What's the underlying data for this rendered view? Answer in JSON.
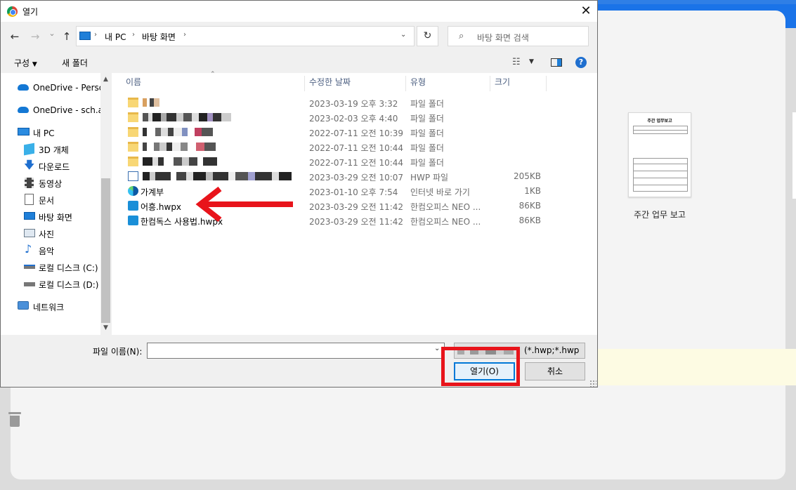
{
  "dialog": {
    "title": "열기",
    "close_glyph": "✕",
    "nav": {
      "back": "←",
      "forward": "→",
      "recent": "⌄",
      "up": "↑"
    },
    "breadcrumb": [
      "내 PC",
      "바탕 화면"
    ],
    "breadcrumb_sep": "›",
    "refresh_glyph": "↻",
    "search_placeholder": "바탕 화면 검색",
    "search_glyph": "⌕",
    "toolbar": {
      "organize": "구성",
      "new_folder": "새 폴더",
      "help": "?"
    },
    "sidebar": [
      {
        "label": "OneDrive - Personal",
        "icon": "onedrive-icon"
      },
      {
        "label": "OneDrive - sch.ac.kr",
        "icon": "onedrive-icon"
      },
      {
        "label": "내 PC",
        "icon": "pc-icon"
      },
      {
        "label": "3D 개체",
        "icon": "3d-objects-icon"
      },
      {
        "label": "다운로드",
        "icon": "download-icon"
      },
      {
        "label": "동영상",
        "icon": "video-icon"
      },
      {
        "label": "문서",
        "icon": "document-icon"
      },
      {
        "label": "바탕 화면",
        "icon": "desktop-icon"
      },
      {
        "label": "사진",
        "icon": "pictures-icon"
      },
      {
        "label": "음악",
        "icon": "music-icon"
      },
      {
        "label": "로컬 디스크 (C:)",
        "icon": "drive-icon"
      },
      {
        "label": "로컬 디스크 (D:)",
        "icon": "drive-icon"
      },
      {
        "label": "네트워크",
        "icon": "network-icon"
      }
    ],
    "columns": {
      "name": "이름",
      "date": "수정한 날짜",
      "type": "유형",
      "size": "크기"
    },
    "files": [
      {
        "name": "",
        "date": "2023-03-19 오후 3:32",
        "type": "파일 폴더",
        "size": "",
        "icon": "folder-icon",
        "blurred": true
      },
      {
        "name": "",
        "date": "2023-02-03 오후 4:40",
        "type": "파일 폴더",
        "size": "",
        "icon": "folder-icon",
        "blurred": true
      },
      {
        "name": "",
        "date": "2022-07-11 오전 10:39",
        "type": "파일 폴더",
        "size": "",
        "icon": "folder-icon",
        "blurred": true
      },
      {
        "name": "",
        "date": "2022-07-11 오전 10:44",
        "type": "파일 폴더",
        "size": "",
        "icon": "folder-icon",
        "blurred": true
      },
      {
        "name": "",
        "date": "2022-07-11 오전 10:44",
        "type": "파일 폴더",
        "size": "",
        "icon": "folder-icon",
        "blurred": true
      },
      {
        "name": "",
        "date": "2023-03-29 오전 10:07",
        "type": "HWP 파일",
        "size": "205KB",
        "icon": "hwp-file-icon",
        "blurred": true
      },
      {
        "name": "가계부",
        "date": "2023-01-10 오후 7:54",
        "type": "인터넷 바로 가기",
        "size": "1KB",
        "icon": "edge-shortcut-icon",
        "blurred": false
      },
      {
        "name": "어흥.hwpx",
        "date": "2023-03-29 오전 11:42",
        "type": "한컴오피스 NEO ...",
        "size": "86KB",
        "icon": "hwpx-file-icon",
        "blurred": false
      },
      {
        "name": "한컴독스 사용법.hwpx",
        "date": "2023-03-29 오전 11:42",
        "type": "한컴오피스 NEO ...",
        "size": "86KB",
        "icon": "hwpx-file-icon",
        "blurred": false
      }
    ],
    "filename_label": "파일 이름(N):",
    "filename_value": "",
    "filter_text": "(*.hwp;*.hwp",
    "open_label": "열기(O)",
    "cancel_label": "취소"
  },
  "background": {
    "thumbnail_title": "주간 업무보고",
    "thumbnail_label": "주간 업무 보고"
  },
  "colors": {
    "annotation_red": "#e8141b",
    "accent_blue": "#0078d7",
    "app_blue": "#1a73e8"
  }
}
